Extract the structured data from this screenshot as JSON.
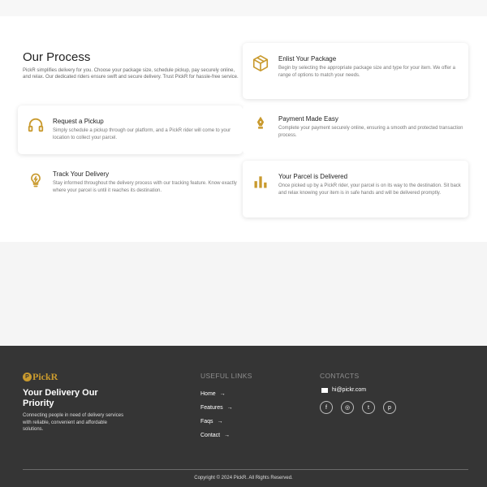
{
  "process": {
    "title": "Our Process",
    "description": "PickR simplifies delivery for you. Choose your package size, schedule pickup, pay securely online, and relax. Our dedicated riders ensure swift and secure delivery. Trust PickR for hassle-free service.",
    "cards": [
      {
        "icon": "headset-icon",
        "title": "Request a Pickup",
        "description": "Simply schedule a pickup through our platform, and a PickR rider will come to your location to collect your parcel."
      },
      {
        "icon": "lightbulb-icon",
        "title": "Track Your Delivery",
        "description": "Stay informed throughout the delivery process with our tracking feature. Know exactly where your parcel is until it reaches its destination."
      },
      {
        "icon": "package-box-icon",
        "title": "Enlist Your Package",
        "description": "Begin by selecting the appropriate package size and type for your item. We offer a range of options to match your needs."
      },
      {
        "icon": "pen-nib-icon",
        "title": "Payment Made Easy",
        "description": "Complete your payment securely online, ensuring a smooth and protected transaction process."
      },
      {
        "icon": "bar-chart-icon",
        "title": "Your Parcel is Delivered",
        "description": "Once picked up by a PickR rider, your parcel is on its way to the destination. Sit back and relax knowing your item is in safe hands and will be delivered promptly."
      }
    ]
  },
  "footer": {
    "brand": "PickR",
    "brand_mark": "P",
    "tagline": "Your Delivery Our Priority",
    "description": "Connecting people in need of delivery services with reliable, convenient and affordable solutions.",
    "useful_links_heading": "USEFUL LINKS",
    "links": [
      "Home",
      "Features",
      "Faqs",
      "Contact"
    ],
    "link_arrow": "→",
    "contacts_heading": "CONTACTS",
    "email": "hi@pickr.com",
    "socials": [
      {
        "icon": "facebook-icon",
        "glyph": "f"
      },
      {
        "icon": "instagram-icon",
        "glyph": "◎"
      },
      {
        "icon": "twitter-icon",
        "glyph": "t"
      },
      {
        "icon": "pinterest-icon",
        "glyph": "p"
      }
    ],
    "copyright": "Copyright © 2024 PickR. All Rights Reserved."
  },
  "colors": {
    "accent": "#c99a2e",
    "footer_bg": "#353535",
    "text_dark": "#222222",
    "text_muted": "#777777"
  }
}
